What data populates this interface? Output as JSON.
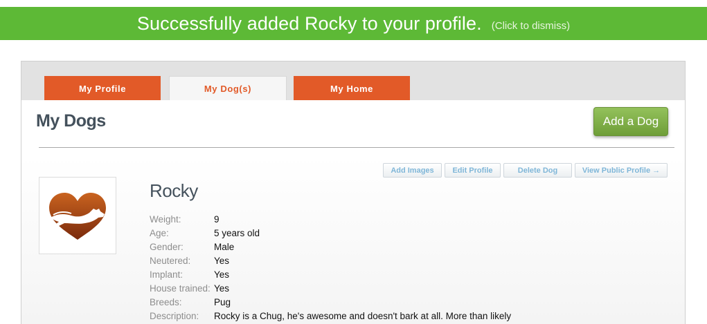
{
  "banner": {
    "message": "Successfully added Rocky to your profile.",
    "dismiss": "(Click to dismiss)"
  },
  "tabs": [
    {
      "label": "My Profile",
      "active": false
    },
    {
      "label": "My Dog(s)",
      "active": true
    },
    {
      "label": "My Home",
      "active": false
    }
  ],
  "page": {
    "title": "My Dogs",
    "add_button": "Add a Dog"
  },
  "actions": {
    "add_images": "Add Images",
    "edit_profile": "Edit Profile",
    "delete_dog": "Delete Dog",
    "view_public": "View Public Profile →"
  },
  "dog": {
    "name": "Rocky",
    "fields": [
      {
        "label": "Weight:",
        "value": "9"
      },
      {
        "label": "Age:",
        "value": "5 years old"
      },
      {
        "label": "Gender:",
        "value": "Male"
      },
      {
        "label": "Neutered:",
        "value": "Yes"
      },
      {
        "label": "Implant:",
        "value": "Yes"
      },
      {
        "label": "House trained:",
        "value": "Yes"
      },
      {
        "label": "Breeds:",
        "value": "Pug"
      },
      {
        "label": "Description:",
        "value": "Rocky is a Chug, he's awesome and doesn't bark at all. More than likely"
      }
    ]
  },
  "colors": {
    "banner_green": "#5db936",
    "tab_orange": "#e25a28",
    "button_green": "#7aa943",
    "title_slate": "#44515c",
    "link_blue": "#7fb6d8"
  },
  "icons": {
    "dog_photo": "heart-dog-logo"
  }
}
